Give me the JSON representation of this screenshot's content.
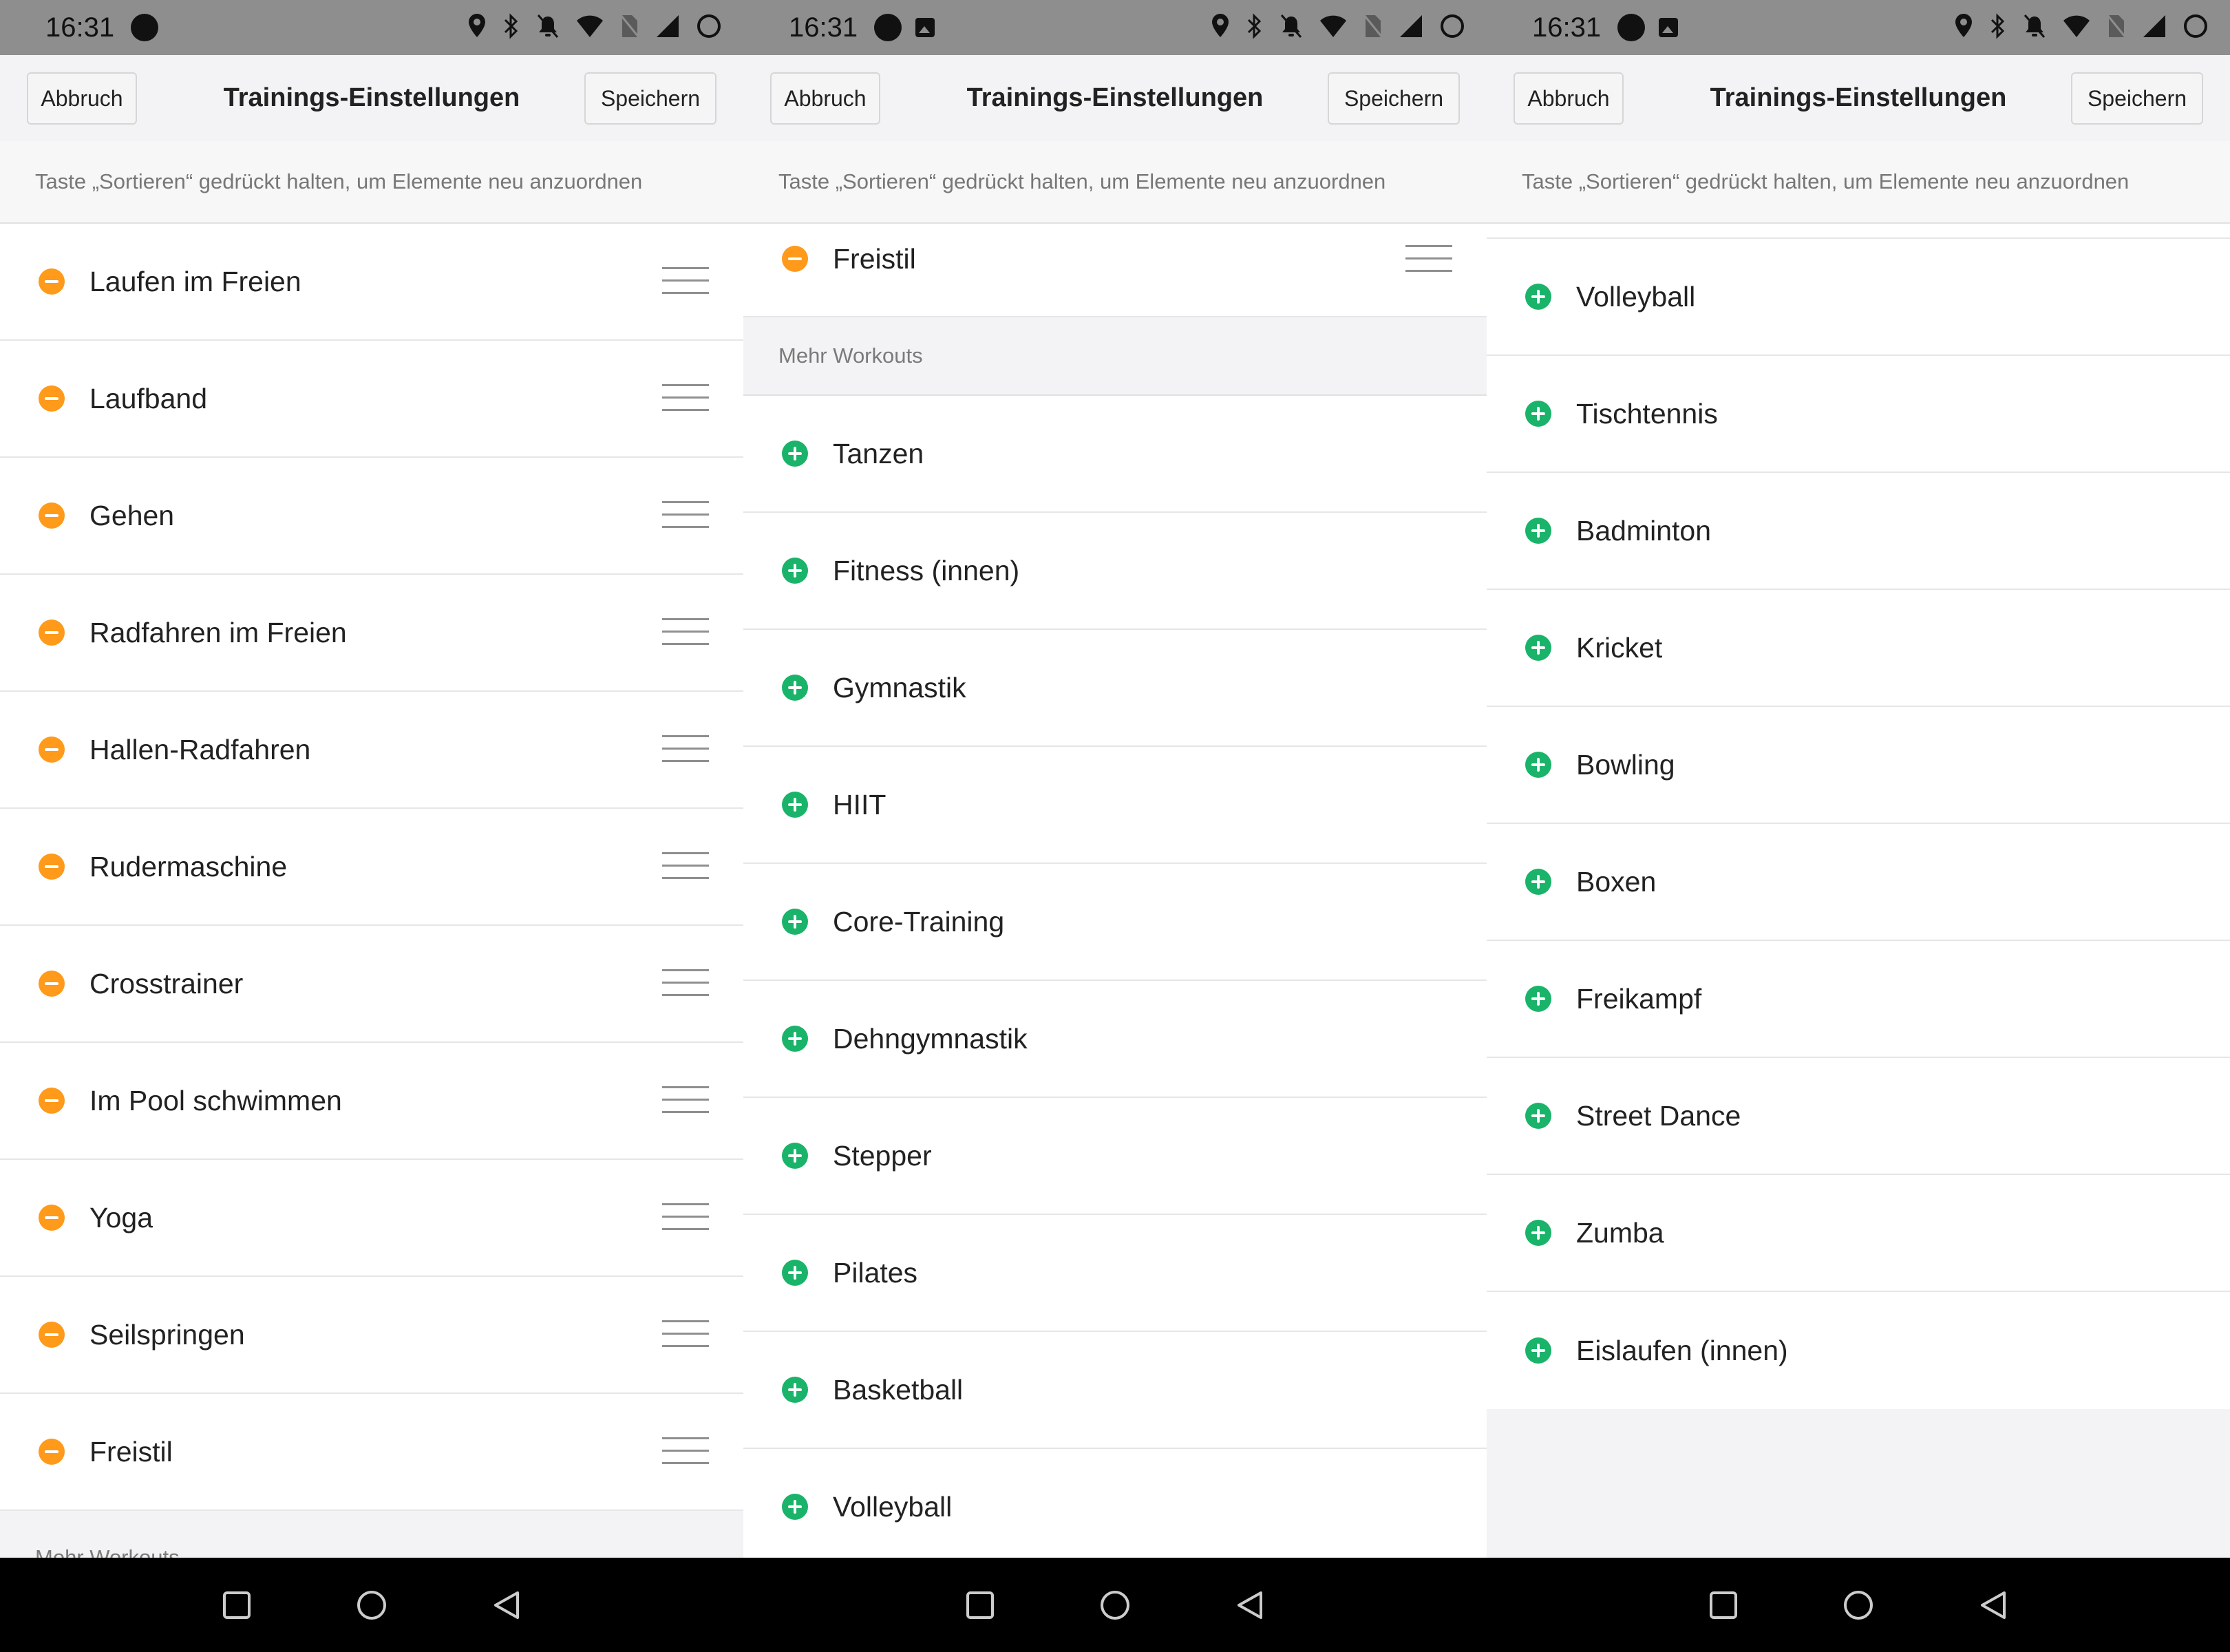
{
  "statusbar": {
    "time": "16:31"
  },
  "appbar": {
    "cancel_label": "Abbruch",
    "title": "Trainings-Einstellungen",
    "save_label": "Speichern"
  },
  "hint": "Taste „Sortieren“ gedrückt halten, um Elemente neu anzuordnen",
  "colors": {
    "remove": "#ff9a1a",
    "add": "#1ab36a"
  },
  "icons": {
    "remove": "minus-circle-icon",
    "add": "plus-circle-icon",
    "drag": "drag-handle-icon"
  },
  "screen1": {
    "items": [
      "Laufen im Freien",
      "Laufband",
      "Gehen",
      "Radfahren im Freien",
      "Hallen-Radfahren",
      "Rudermaschine",
      "Crosstrainer",
      "Im Pool schwimmen",
      "Yoga",
      "Seilspringen",
      "Freistil"
    ],
    "section": "Mehr Workouts"
  },
  "screen2": {
    "top_item": "Freistil",
    "section": "Mehr Workouts",
    "items": [
      "Tanzen",
      "Fitness (innen)",
      "Gymnastik",
      "HIIT",
      "Core-Training",
      "Dehngymnastik",
      "Stepper",
      "Pilates",
      "Basketball",
      "Volleyball"
    ]
  },
  "screen3": {
    "items": [
      "Volleyball",
      "Tischtennis",
      "Badminton",
      "Kricket",
      "Bowling",
      "Boxen",
      "Freikampf",
      "Street Dance",
      "Zumba",
      "Eislaufen (innen)"
    ]
  }
}
